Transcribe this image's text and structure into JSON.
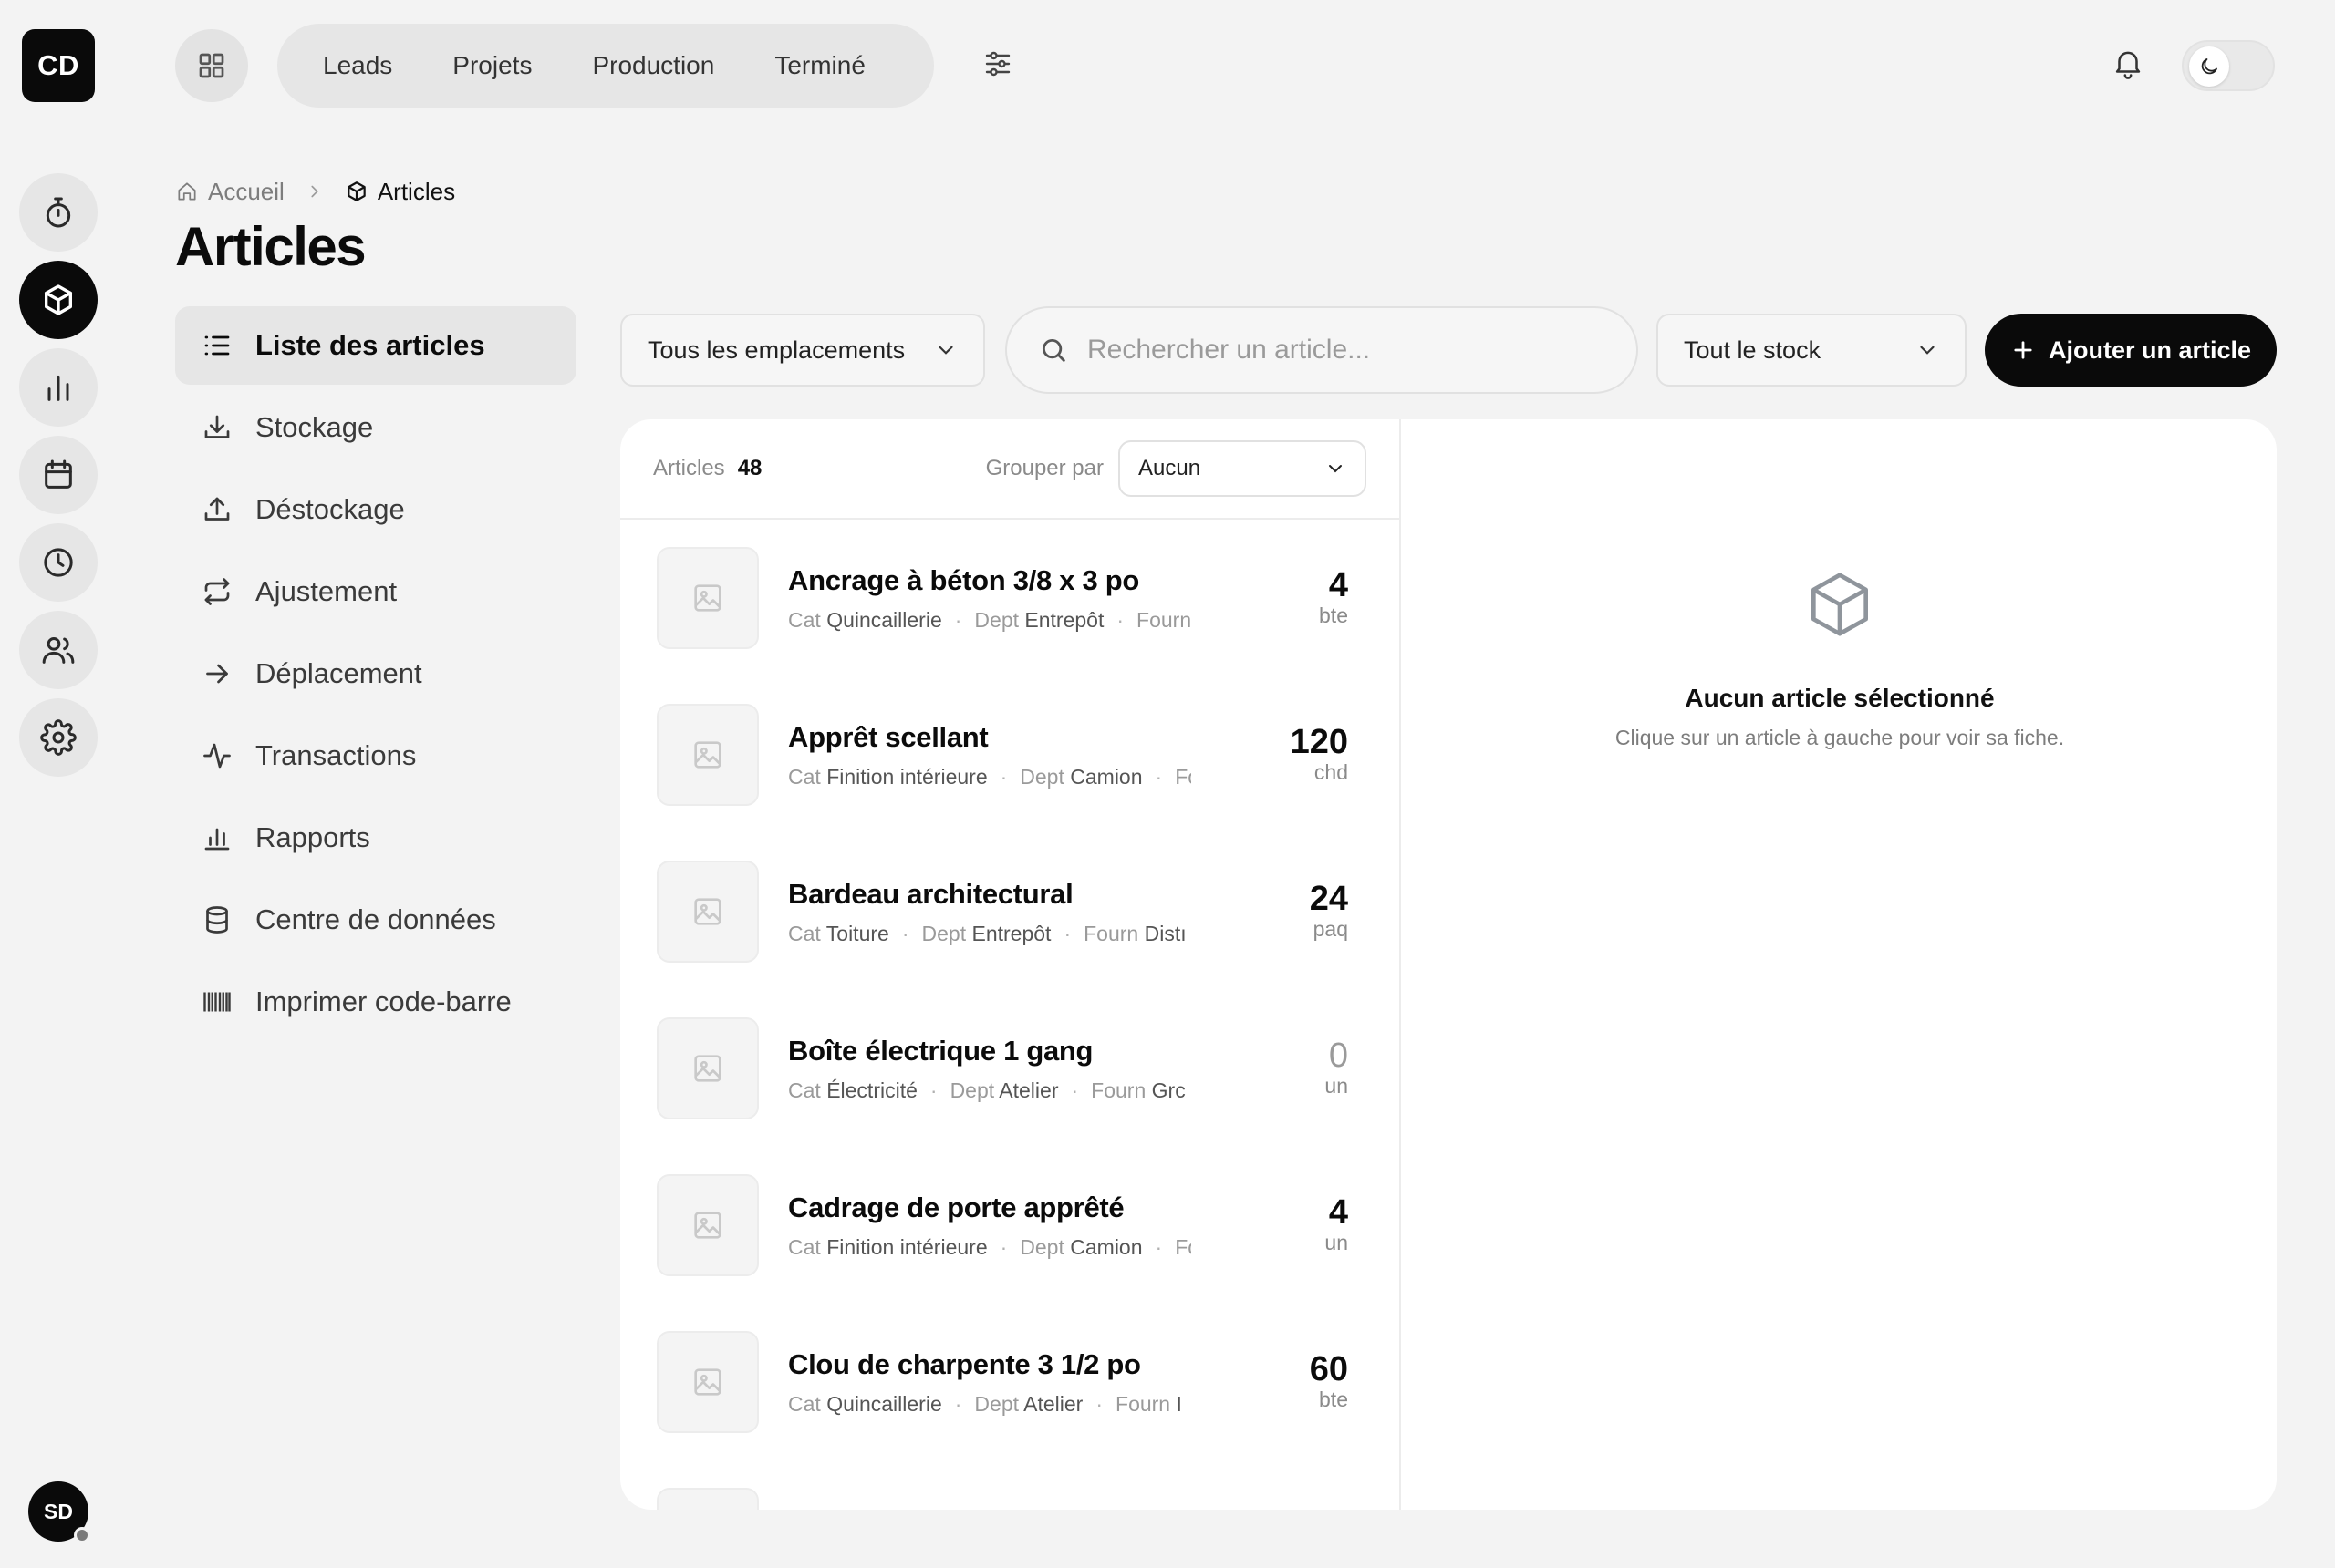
{
  "rail": {
    "logo": "CD",
    "items": [
      {
        "icon": "timer-icon",
        "active": false
      },
      {
        "icon": "box-icon",
        "active": true
      },
      {
        "icon": "bar-chart-icon",
        "active": false
      },
      {
        "icon": "calendar-icon",
        "active": false
      },
      {
        "icon": "clock-icon",
        "active": false
      },
      {
        "icon": "users-icon",
        "active": false
      },
      {
        "icon": "gear-icon",
        "active": false
      }
    ],
    "user_avatar": "SD"
  },
  "topbar": {
    "tabs": [
      {
        "label": "Leads"
      },
      {
        "label": "Projets"
      },
      {
        "label": "Production"
      },
      {
        "label": "Terminé"
      }
    ]
  },
  "breadcrumb": {
    "home": "Accueil",
    "current": "Articles"
  },
  "page_title": "Articles",
  "subnav": {
    "items": [
      {
        "label": "Liste des articles",
        "icon": "list-icon",
        "active": true
      },
      {
        "label": "Stockage",
        "icon": "download-icon",
        "active": false
      },
      {
        "label": "Déstockage",
        "icon": "upload-icon",
        "active": false
      },
      {
        "label": "Ajustement",
        "icon": "repeat-icon",
        "active": false
      },
      {
        "label": "Déplacement",
        "icon": "arrow-right-icon",
        "active": false
      },
      {
        "label": "Transactions",
        "icon": "activity-icon",
        "active": false
      },
      {
        "label": "Rapports",
        "icon": "bar-chart-icon",
        "active": false
      },
      {
        "label": "Centre de données",
        "icon": "database-icon",
        "active": false
      },
      {
        "label": "Imprimer code-barre",
        "icon": "barcode-icon",
        "active": false
      }
    ]
  },
  "toolbar": {
    "location_select": "Tous les emplacements",
    "search_placeholder": "Rechercher un article...",
    "search_value": "",
    "stock_select": "Tout le stock",
    "add_label": "Ajouter un article"
  },
  "list": {
    "count_label": "Articles",
    "count": "48",
    "group_label": "Grouper par",
    "group_value": "Aucun",
    "meta_keys": {
      "cat": "Cat",
      "dept": "Dept",
      "fourn": "Fourn"
    },
    "items": [
      {
        "name": "Ancrage à béton 3/8 x 3 po",
        "cat": "Quincaillerie",
        "dept": "Entrepôt",
        "fourn": "",
        "qty": "4",
        "unit": "bte"
      },
      {
        "name": "Apprêt scellant",
        "cat": "Finition intérieure",
        "dept": "Camion",
        "fourn": "",
        "qty": "120",
        "unit": "chd"
      },
      {
        "name": "Bardeau architectural",
        "cat": "Toiture",
        "dept": "Entrepôt",
        "fourn": "Distı",
        "qty": "24",
        "unit": "paq"
      },
      {
        "name": "Boîte électrique 1 gang",
        "cat": "Électricité",
        "dept": "Atelier",
        "fourn": "Grc",
        "qty": "0",
        "unit": "un"
      },
      {
        "name": "Cadrage de porte apprêté",
        "cat": "Finition intérieure",
        "dept": "Camion",
        "fourn": "",
        "qty": "4",
        "unit": "un"
      },
      {
        "name": "Clou de charpente 3 1/2 po",
        "cat": "Quincaillerie",
        "dept": "Atelier",
        "fourn": "I",
        "qty": "60",
        "unit": "bte"
      }
    ]
  },
  "detail": {
    "empty_title": "Aucun article sélectionné",
    "empty_subtitle": "Clique sur un article à gauche pour voir sa fiche."
  }
}
